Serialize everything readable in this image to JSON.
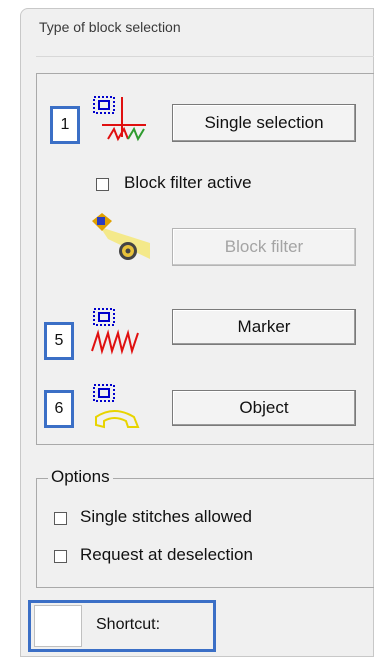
{
  "panel": {
    "title": "Type of block selection"
  },
  "badges": {
    "single": "1",
    "marker": "5",
    "object": "6"
  },
  "buttons": {
    "single_selection": "Single selection",
    "block_filter": "Block filter",
    "marker": "Marker",
    "object": "Object"
  },
  "checkboxes": {
    "block_filter_active": {
      "label": "Block filter active",
      "checked": false
    }
  },
  "options": {
    "title": "Options",
    "single_stitches_allowed": {
      "label": "Single stitches allowed",
      "checked": false
    },
    "request_at_deselection": {
      "label": "Request at deselection",
      "checked": false
    }
  },
  "shortcut": {
    "label": "Shortcut:"
  },
  "colors": {
    "highlight_border": "#3b6fc6",
    "panel_bg": "#f0f0f0",
    "disabled_text": "#a4a4a4"
  },
  "icons": {
    "single": "single-selection-icon",
    "block_filter": "block-filter-icon",
    "marker": "marker-icon",
    "object": "object-icon"
  }
}
